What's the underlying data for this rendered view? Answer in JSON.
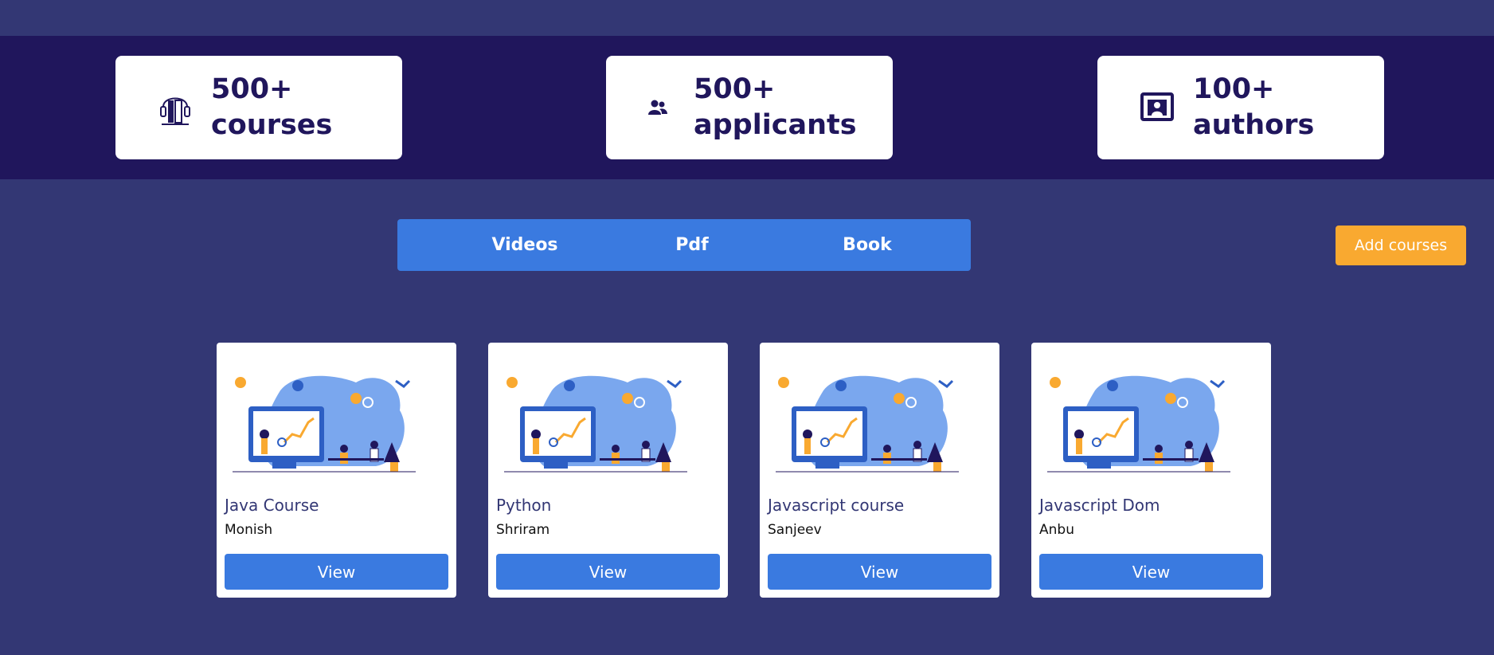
{
  "stats": [
    {
      "number": "500+",
      "label": "courses",
      "icon": "book-headphones-icon"
    },
    {
      "number": "500+",
      "label": "applicants",
      "icon": "users-icon"
    },
    {
      "number": "100+",
      "label": "authors",
      "icon": "author-portrait-icon"
    }
  ],
  "tabs": [
    {
      "label": "Videos"
    },
    {
      "label": "Pdf"
    },
    {
      "label": "Book"
    }
  ],
  "add_courses_label": "Add courses",
  "courses": [
    {
      "title": "Java Course",
      "author": "Monish",
      "view_label": "View"
    },
    {
      "title": "Python",
      "author": "Shriram",
      "view_label": "View"
    },
    {
      "title": "Javascript course",
      "author": "Sanjeev",
      "view_label": "View"
    },
    {
      "title": "Javascript Dom",
      "author": "Anbu",
      "view_label": "View"
    }
  ],
  "colors": {
    "page_bg": "#333774",
    "band_bg": "#20165c",
    "accent_blue": "#3a7ae0",
    "accent_orange": "#f9a930"
  }
}
